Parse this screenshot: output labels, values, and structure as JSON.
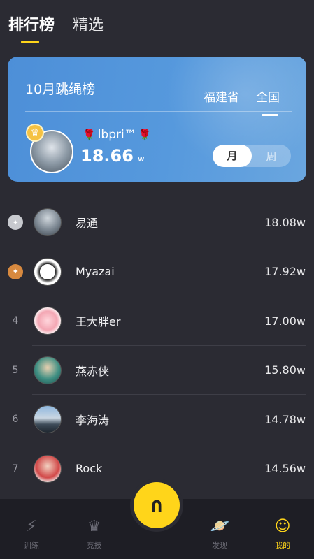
{
  "top_tabs": [
    {
      "label": "排行榜"
    },
    {
      "label": "精选"
    }
  ],
  "card": {
    "title": "10月跳绳榜",
    "region_tabs": [
      {
        "label": "福建省"
      },
      {
        "label": "全国"
      }
    ],
    "champion": {
      "name": "lbpri™",
      "score": "18.66",
      "unit": "w",
      "badge_icon": "crown-medal-icon"
    },
    "period": {
      "options": [
        "月",
        "周"
      ],
      "selected": "月"
    }
  },
  "ranking": [
    {
      "rank": "",
      "medal": "silver",
      "name": "易通",
      "score": "18.08w"
    },
    {
      "rank": "",
      "medal": "bronze",
      "name": "Myazai",
      "score": "17.92w"
    },
    {
      "rank": "4",
      "medal": "",
      "name": "王大胖er",
      "score": "17.00w"
    },
    {
      "rank": "5",
      "medal": "",
      "name": "燕赤侠",
      "score": "15.80w"
    },
    {
      "rank": "6",
      "medal": "",
      "name": "李海涛",
      "score": "14.78w"
    },
    {
      "rank": "7",
      "medal": "",
      "name": "Rock",
      "score": "14.56w"
    }
  ],
  "bottom_nav": [
    {
      "label": "训练",
      "icon": "lightning-icon"
    },
    {
      "label": "竞技",
      "icon": "crown-icon"
    },
    {
      "label": "",
      "icon": "fab-start-icon"
    },
    {
      "label": "发现",
      "icon": "planet-icon"
    },
    {
      "label": "我的",
      "icon": "smile-face-icon"
    }
  ],
  "colors": {
    "accent": "#ffd51a",
    "card_blue": "#5699dd",
    "background": "#2b2b33"
  }
}
